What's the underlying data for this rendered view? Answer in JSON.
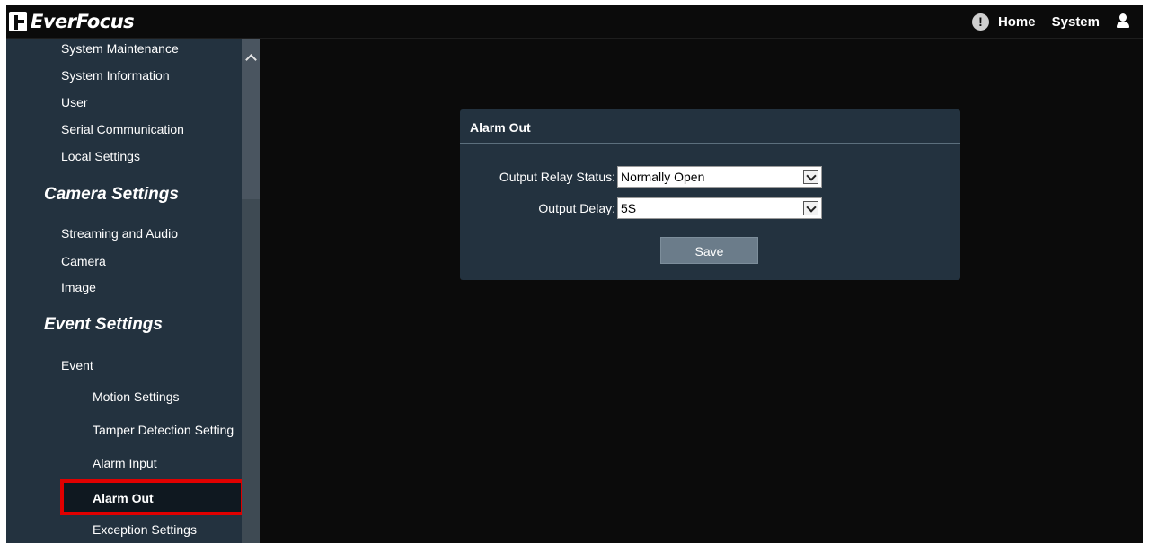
{
  "app": {
    "brand": "EverFocus"
  },
  "topnav": {
    "home_label": "Home",
    "system_label": "System"
  },
  "sidebar": {
    "items_top": [
      "System Maintenance",
      "System Information",
      "User",
      "Serial Communication",
      "Local Settings"
    ],
    "camera_heading": "Camera Settings",
    "camera_items": [
      "Streaming and Audio",
      "Camera",
      "Image"
    ],
    "event_heading": "Event Settings",
    "event_group": "Event",
    "event_items": [
      "Motion Settings",
      "Tamper Detection Setting",
      "Alarm Input",
      "Alarm Out",
      "Exception Settings"
    ],
    "active_item": "Alarm Out"
  },
  "panel": {
    "title": "Alarm Out",
    "output_relay_status_label": "Output Relay Status:",
    "output_relay_status_value": "Normally Open",
    "output_delay_label": "Output Delay:",
    "output_delay_value": "5S",
    "save_label": "Save"
  },
  "colors": {
    "highlight": "#e00000",
    "sidebar_bg": "#23323f",
    "panel_bg": "#23323f"
  }
}
